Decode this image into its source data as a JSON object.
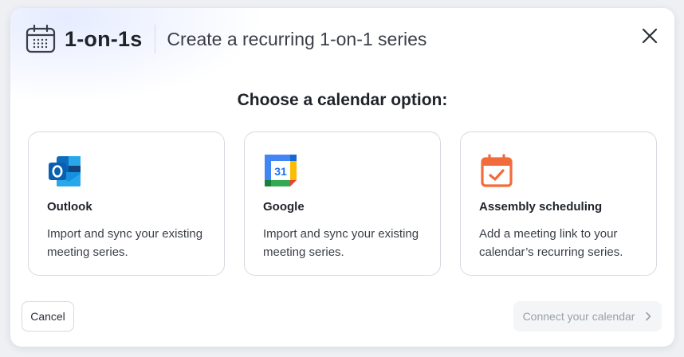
{
  "header": {
    "title": "1-on-1s",
    "subtitle": "Create a recurring 1-on-1 series",
    "icon": "calendar-icon"
  },
  "close": {
    "icon": "close-icon"
  },
  "heading": "Choose a calendar option:",
  "cards": [
    {
      "icon": "outlook-icon",
      "title": "Outlook",
      "description": "Import and sync your existing meeting series."
    },
    {
      "icon": "google-calendar-icon",
      "title": "Google",
      "description": "Import and sync your existing meeting series.",
      "icon_text": "31"
    },
    {
      "icon": "assembly-calendar-icon",
      "title": "Assembly scheduling",
      "description": "Add a meeting link to your calendar’s recurring series."
    }
  ],
  "footer": {
    "cancel_label": "Cancel",
    "connect_label": "Connect your calendar",
    "connect_disabled": true
  },
  "colors": {
    "outlook_blue": "#0f6cbd",
    "google_blue": "#1a73e8",
    "assembly_orange": "#f26b3a"
  }
}
